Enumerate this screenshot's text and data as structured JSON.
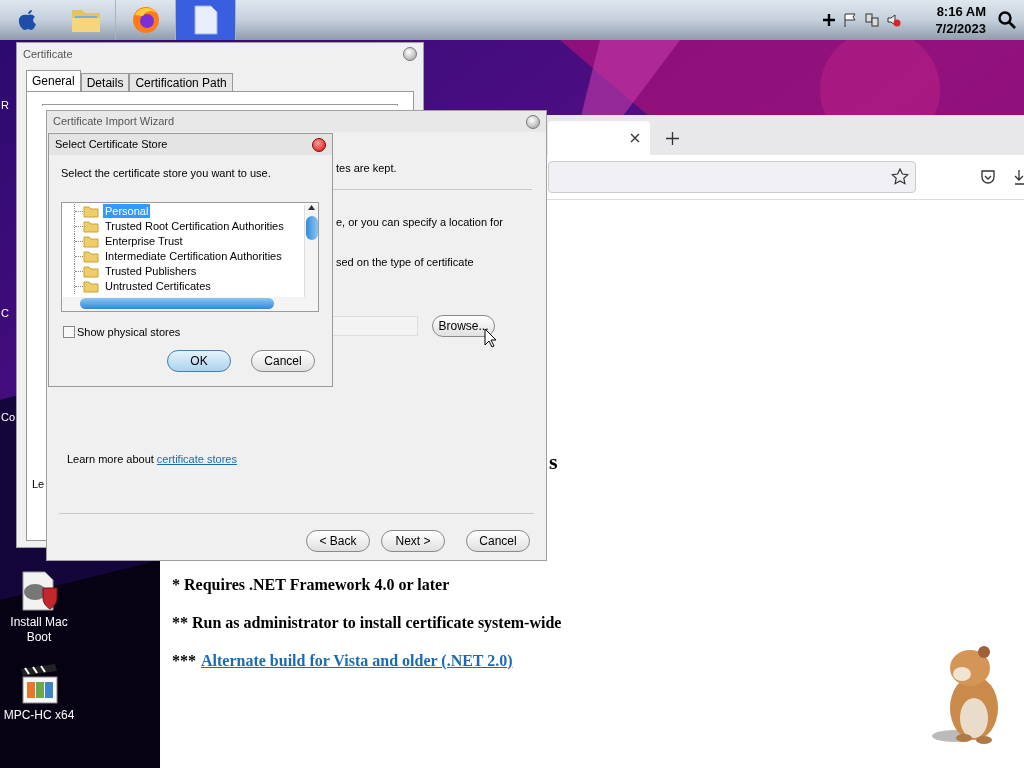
{
  "menubar": {
    "apps": [
      {
        "kind": "folder",
        "selected": false
      },
      {
        "kind": "browser",
        "selected": false
      },
      {
        "kind": "document",
        "selected": true
      }
    ],
    "time": "8:16 AM",
    "date": "7/2/2023"
  },
  "desktop": {
    "label_fragments": [
      "R",
      "C",
      "Co"
    ],
    "icons": [
      {
        "kind": "installer",
        "label": "Install Mac Boot"
      },
      {
        "kind": "player",
        "label": "MPC-HC x64"
      }
    ]
  },
  "browser": {
    "heading_fragment": "s",
    "notes": [
      {
        "kind": "text",
        "text": "* Requires .NET Framework 4.0 or later"
      },
      {
        "kind": "text",
        "text": "** Run as administrator to install certificate system-wide"
      },
      {
        "kind": "link",
        "prefix": "***",
        "text": "Alternate build for Vista and older (.NET 2.0)"
      }
    ]
  },
  "certificate_window": {
    "title": "Certificate",
    "tabs": [
      {
        "label": "General",
        "selected": true
      },
      {
        "label": "Details",
        "selected": false
      },
      {
        "label": "Certification Path",
        "selected": false
      }
    ],
    "text_fragment": "Le"
  },
  "import_wizard": {
    "title": "Certificate Import Wizard",
    "text_fragments": [
      "tes are kept.",
      "e, or you can specify a location for",
      "sed on the type of certificate"
    ],
    "browse_button": "Browse...",
    "learn_more": {
      "text": "Learn more about",
      "link": "certificate stores"
    },
    "buttons": [
      "< Back",
      "Next >",
      "Cancel"
    ]
  },
  "store_dialog": {
    "title": "Select Certificate Store",
    "prompt": "Select the certificate store you want to use.",
    "stores": [
      {
        "label": "Personal",
        "selected": true
      },
      {
        "label": "Trusted Root Certification Authorities",
        "selected": false
      },
      {
        "label": "Enterprise Trust",
        "selected": false
      },
      {
        "label": "Intermediate Certification Authorities",
        "selected": false
      },
      {
        "label": "Trusted Publishers",
        "selected": false
      },
      {
        "label": "Untrusted Certificates",
        "selected": false
      }
    ],
    "show_physical": {
      "label": "Show physical stores",
      "checked": false
    },
    "buttons": [
      {
        "label": "OK",
        "default": true
      },
      {
        "label": "Cancel",
        "default": false
      }
    ]
  }
}
